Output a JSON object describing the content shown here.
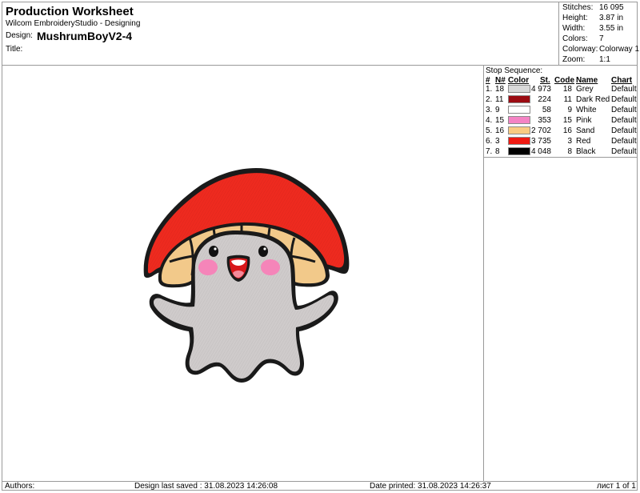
{
  "header": {
    "title": "Production Worksheet",
    "software": "Wilcom EmbroideryStudio - Designing",
    "design_label": "Design:",
    "design_name": "MushrumBoyV2-4",
    "title_label": "Title:"
  },
  "stats": [
    {
      "label": "Stitches:",
      "value": "16 095"
    },
    {
      "label": "Height:",
      "value": "3.87 in"
    },
    {
      "label": "Width:",
      "value": "3.55 in"
    },
    {
      "label": "Colors:",
      "value": "7"
    },
    {
      "label": "Colorway:",
      "value": "Colorway 1"
    },
    {
      "label": "Zoom:",
      "value": "1:1"
    }
  ],
  "stop_sequence": {
    "title": "Stop Sequence:",
    "headers": {
      "num": "#",
      "n": "N#",
      "color": "Color",
      "st": "St.",
      "code": "Code",
      "name": "Name",
      "chart": "Chart"
    },
    "rows": [
      {
        "num": "1.",
        "n": "18",
        "color": "#d9d9d9",
        "st": "4 973",
        "code": "18",
        "name": "Grey",
        "chart": "Default"
      },
      {
        "num": "2.",
        "n": "11",
        "color": "#9b0b12",
        "st": "224",
        "code": "11",
        "name": "Dark Red",
        "chart": "Default"
      },
      {
        "num": "3.",
        "n": "9",
        "color": "#ffffff",
        "st": "58",
        "code": "9",
        "name": "White",
        "chart": "Default"
      },
      {
        "num": "4.",
        "n": "15",
        "color": "#f483c4",
        "st": "353",
        "code": "15",
        "name": "Pink",
        "chart": "Default"
      },
      {
        "num": "5.",
        "n": "16",
        "color": "#f9cb82",
        "st": "2 702",
        "code": "16",
        "name": "Sand",
        "chart": "Default"
      },
      {
        "num": "6.",
        "n": "3",
        "color": "#ef1a12",
        "st": "3 735",
        "code": "3",
        "name": "Red",
        "chart": "Default"
      },
      {
        "num": "7.",
        "n": "8",
        "color": "#000000",
        "st": "4 048",
        "code": "8",
        "name": "Black",
        "chart": "Default"
      }
    ]
  },
  "footer": {
    "authors": "Authors:",
    "last_saved": "Design last saved : 31.08.2023 14:26:08",
    "printed": "Date printed: 31.08.2023 14:26:37",
    "page": "лист 1 of 1"
  },
  "artwork": {
    "description_icon": "mushroom-boy-embroidery",
    "colors": {
      "cap": "#ee2a1f",
      "cap_shade": "#c9150f",
      "gills": "#f2c98a",
      "body": "#cfcbcb",
      "outline": "#1a1a1a",
      "blush": "#f585b9",
      "mouth": "#d8171a",
      "tongue": "#f48a9a"
    }
  }
}
